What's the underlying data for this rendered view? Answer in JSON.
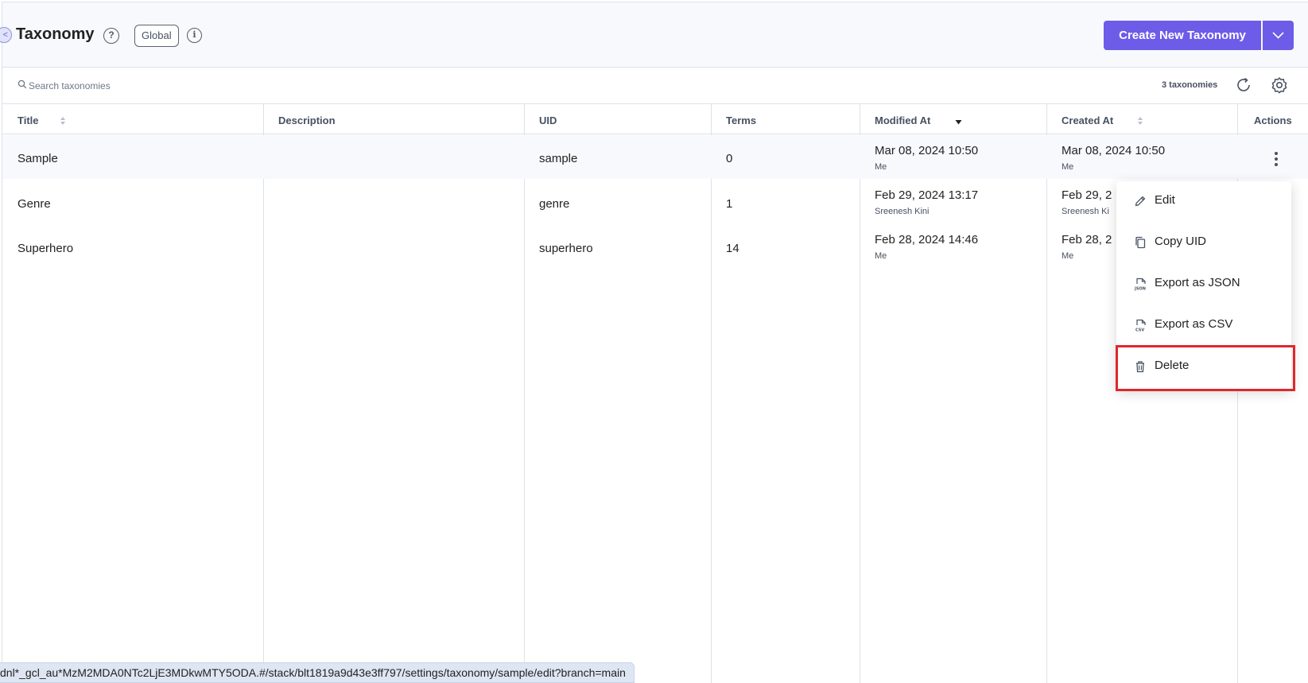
{
  "header": {
    "back_glyph": "<",
    "title": "Taxonomy",
    "help_glyph": "?",
    "scope_badge": "Global",
    "info_glyph": "i",
    "create_button": "Create New Taxonomy"
  },
  "toolbar": {
    "search_placeholder": "Search taxonomies",
    "count": "3 taxonomies"
  },
  "table": {
    "columns": {
      "title": "Title",
      "description": "Description",
      "uid": "UID",
      "terms": "Terms",
      "modified": "Modified At",
      "created": "Created At",
      "actions": "Actions"
    },
    "rows": [
      {
        "title": "Sample",
        "description": "",
        "uid": "sample",
        "terms": "0",
        "modified_at": "Mar 08, 2024 10:50",
        "modified_by": "Me",
        "created_at": "Mar 08, 2024 10:50",
        "created_by": "Me"
      },
      {
        "title": "Genre",
        "description": "",
        "uid": "genre",
        "terms": "1",
        "modified_at": "Feb 29, 2024 13:17",
        "modified_by": "Sreenesh Kini",
        "created_at": "Feb 29, 2",
        "created_by": "Sreenesh Ki"
      },
      {
        "title": "Superhero",
        "description": "",
        "uid": "superhero",
        "terms": "14",
        "modified_at": "Feb 28, 2024 14:46",
        "modified_by": "Me",
        "created_at": "Feb 28, 2",
        "created_by": "Me"
      }
    ]
  },
  "actions_menu": {
    "items": [
      {
        "label": "Edit",
        "icon": "pencil-icon"
      },
      {
        "label": "Copy UID",
        "icon": "copy-icon"
      },
      {
        "label": "Export as JSON",
        "icon": "json-file-icon",
        "icon_text": "JSON"
      },
      {
        "label": "Export as CSV",
        "icon": "csv-file-icon",
        "icon_text": "CSV"
      },
      {
        "label": "Delete",
        "icon": "trash-icon"
      }
    ]
  },
  "status_bar": {
    "url": "dnl*_gcl_au*MzM2MDA0NTc2LjE3MDkwMTY5ODA.#/stack/blt1819a9d43e3ff797/settings/taxonomy/sample/edit?branch=main"
  },
  "colors": {
    "primary": "#6c5ce7",
    "highlight_border": "#e0262b",
    "header_bg": "#f7f9fc",
    "divider": "#dde1e8"
  }
}
